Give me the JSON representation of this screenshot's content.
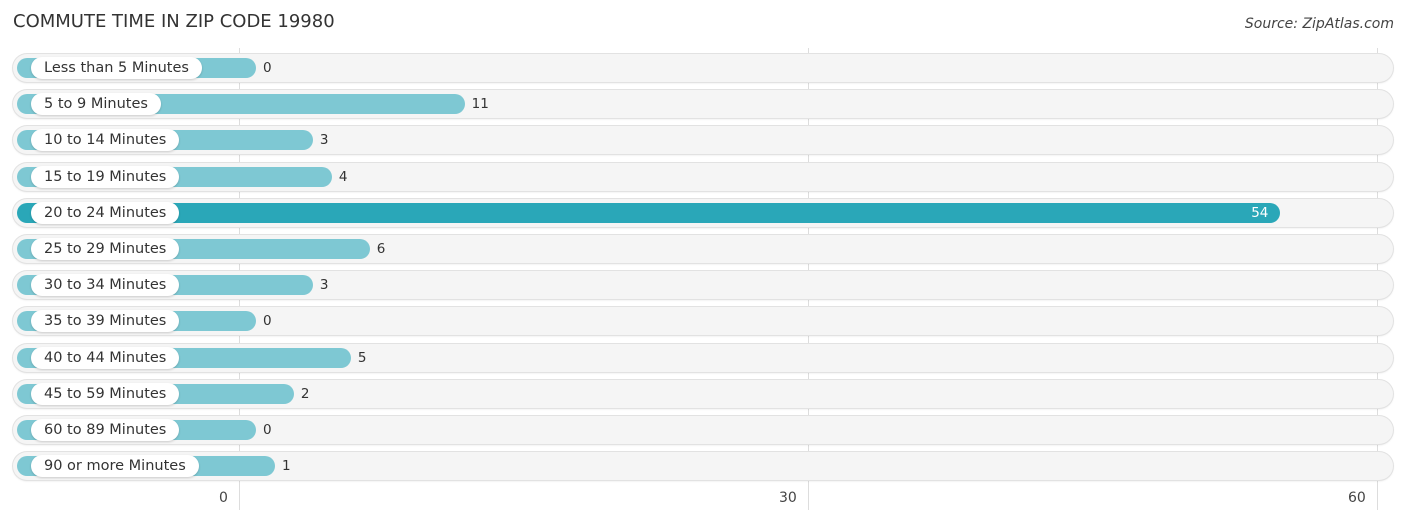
{
  "title": "COMMUTE TIME IN ZIP CODE 19980",
  "source": "Source: ZipAtlas.com",
  "colors": {
    "bar": "#7ec8d3",
    "highlight": "#2aa7b8",
    "track": "#f5f5f5"
  },
  "chart_data": {
    "type": "bar",
    "orientation": "horizontal",
    "title": "COMMUTE TIME IN ZIP CODE 19980",
    "categories": [
      "Less than 5 Minutes",
      "5 to 9 Minutes",
      "10 to 14 Minutes",
      "15 to 19 Minutes",
      "20 to 24 Minutes",
      "25 to 29 Minutes",
      "30 to 34 Minutes",
      "35 to 39 Minutes",
      "40 to 44 Minutes",
      "45 to 59 Minutes",
      "60 to 89 Minutes",
      "90 or more Minutes"
    ],
    "values": [
      0,
      11,
      3,
      4,
      54,
      6,
      3,
      0,
      5,
      2,
      0,
      1
    ],
    "highlight_index": 4,
    "xlim": [
      0,
      60
    ],
    "xticks": [
      "0",
      "30",
      "60"
    ],
    "xlabel": "",
    "ylabel": "",
    "grid": true
  }
}
